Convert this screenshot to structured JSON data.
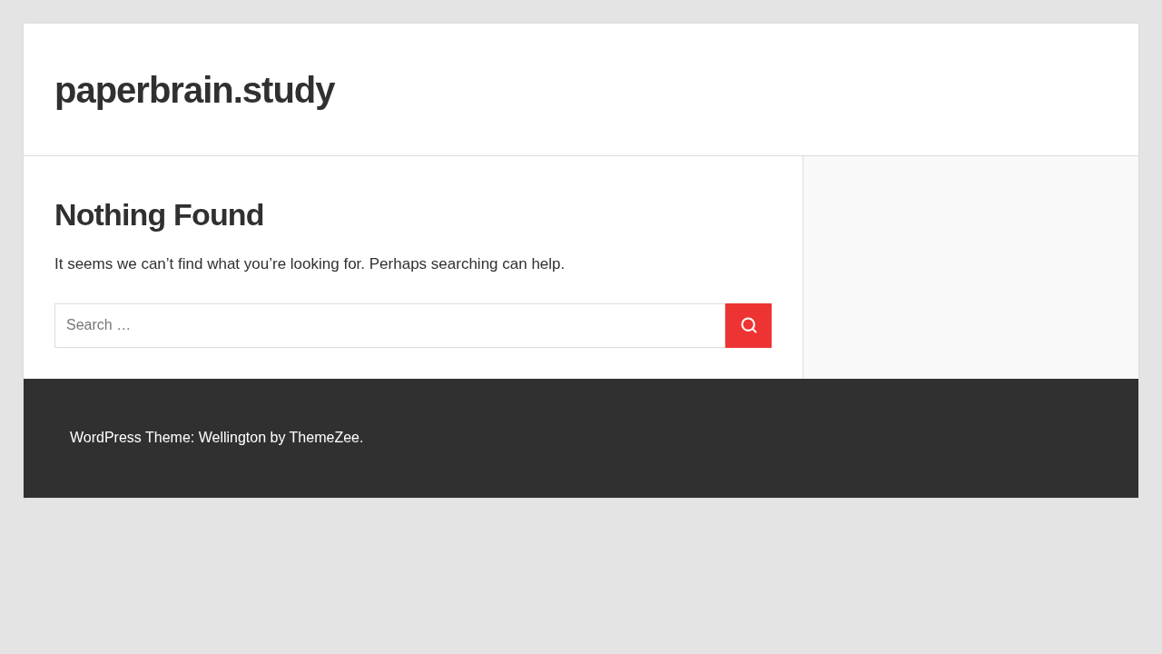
{
  "site_title": "paperbrain.study",
  "content": {
    "heading": "Nothing Found",
    "message": "It seems we can’t find what you’re looking for. Perhaps searching can help.",
    "search": {
      "placeholder": "Search …"
    }
  },
  "footer": {
    "credit": "WordPress Theme: Wellington by ThemeZee."
  }
}
